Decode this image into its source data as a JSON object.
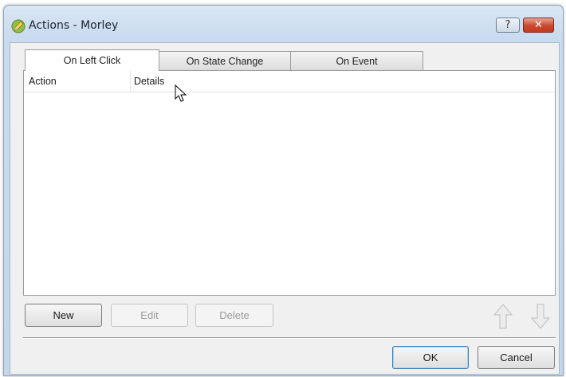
{
  "window": {
    "title": "Actions - Morley",
    "help_label": "?",
    "close_label": "✕"
  },
  "tabs": [
    {
      "label": "On Left Click",
      "active": true
    },
    {
      "label": "On State Change",
      "active": false
    },
    {
      "label": "On Event",
      "active": false
    }
  ],
  "list": {
    "columns": [
      "Action",
      "Details"
    ],
    "rows": []
  },
  "buttons": {
    "new": "New",
    "edit": "Edit",
    "delete": "Delete",
    "ok": "OK",
    "cancel": "Cancel"
  },
  "icons": {
    "app": "pencil-icon",
    "move_up": "arrow-up-icon",
    "move_down": "arrow-down-icon"
  },
  "colors": {
    "title_gradient_top": "#d9e6f3",
    "close_button": "#c9492f",
    "default_button_border": "#3c7fb1"
  }
}
